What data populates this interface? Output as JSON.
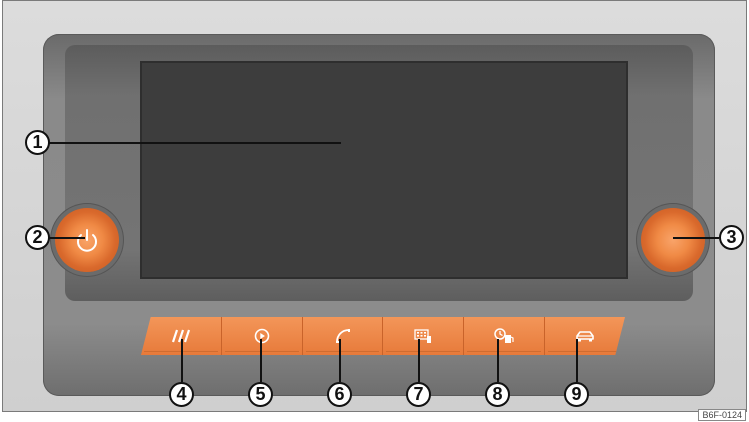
{
  "callouts": {
    "c1": "1",
    "c2": "2",
    "c3": "3",
    "c4": "4",
    "c5": "5",
    "c6": "6",
    "c7": "7",
    "c8": "8",
    "c9": "9"
  },
  "buttons": [
    {
      "icon": "menu-slashes-icon"
    },
    {
      "icon": "media-play-icon"
    },
    {
      "icon": "phone-handset-icon"
    },
    {
      "icon": "keypad-icon"
    },
    {
      "icon": "fuel-clock-icon"
    },
    {
      "icon": "car-icon"
    }
  ],
  "left_knob_icon": "power-icon",
  "reference_code": "B6F-0124",
  "colors": {
    "accent": "#ee823f",
    "screen": "#3d3d3d",
    "bezel": "#7c7c7c"
  }
}
